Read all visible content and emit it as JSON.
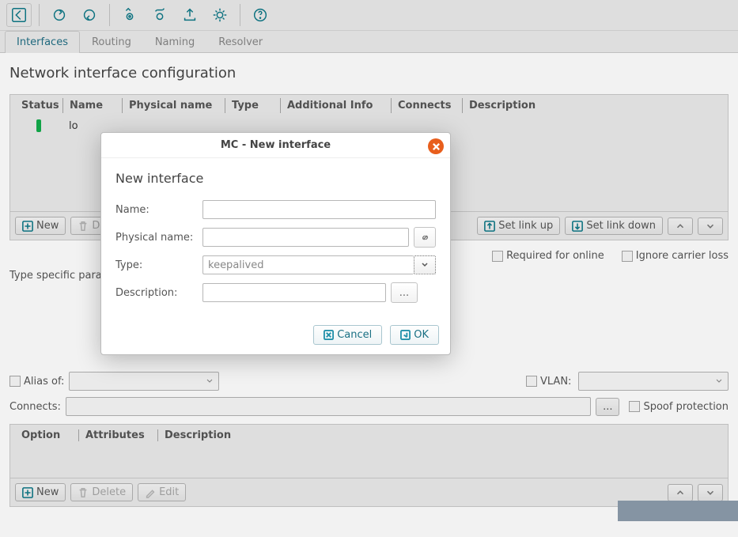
{
  "toolbar": {
    "icons": [
      "back",
      "reload-right",
      "reload-left",
      "view-settings",
      "transfer-settings",
      "upload",
      "gear",
      "help"
    ]
  },
  "tabs": [
    {
      "label": "Interfaces",
      "active": true
    },
    {
      "label": "Routing",
      "active": false
    },
    {
      "label": "Naming",
      "active": false
    },
    {
      "label": "Resolver",
      "active": false
    }
  ],
  "page": {
    "heading": "Network interface configuration"
  },
  "iface_table": {
    "columns": [
      "Status",
      "Name",
      "Physical name",
      "Type",
      "Additional Info",
      "Connects",
      "Description"
    ],
    "rows": [
      {
        "status": "up",
        "name": "lo",
        "phys": "",
        "type": "",
        "addl": "",
        "connects": "",
        "desc": ""
      }
    ],
    "buttons": {
      "new": "New",
      "delete": "D",
      "set_link_up": "Set link up",
      "set_link_down": "Set link down"
    }
  },
  "iface_opts": {
    "required_for_online": "Required for online",
    "ignore_carrier_loss": "Ignore carrier loss",
    "type_specific": "Type specific para",
    "alias_of": "Alias of:",
    "vlan": "VLAN:",
    "connects": "Connects:",
    "spoof": "Spoof protection",
    "ellipsis": "..."
  },
  "option_table": {
    "columns": [
      "Option",
      "Attributes",
      "Description"
    ],
    "buttons": {
      "new": "New",
      "delete": "Delete",
      "edit": "Edit"
    }
  },
  "modal": {
    "window_title": "MC - New interface",
    "heading": "New interface",
    "labels": {
      "name": "Name:",
      "phys": "Physical name:",
      "type": "Type:",
      "desc": "Description:"
    },
    "type_value": "keepalived",
    "desc_btn": "...",
    "cancel": "Cancel",
    "ok": "OK"
  }
}
